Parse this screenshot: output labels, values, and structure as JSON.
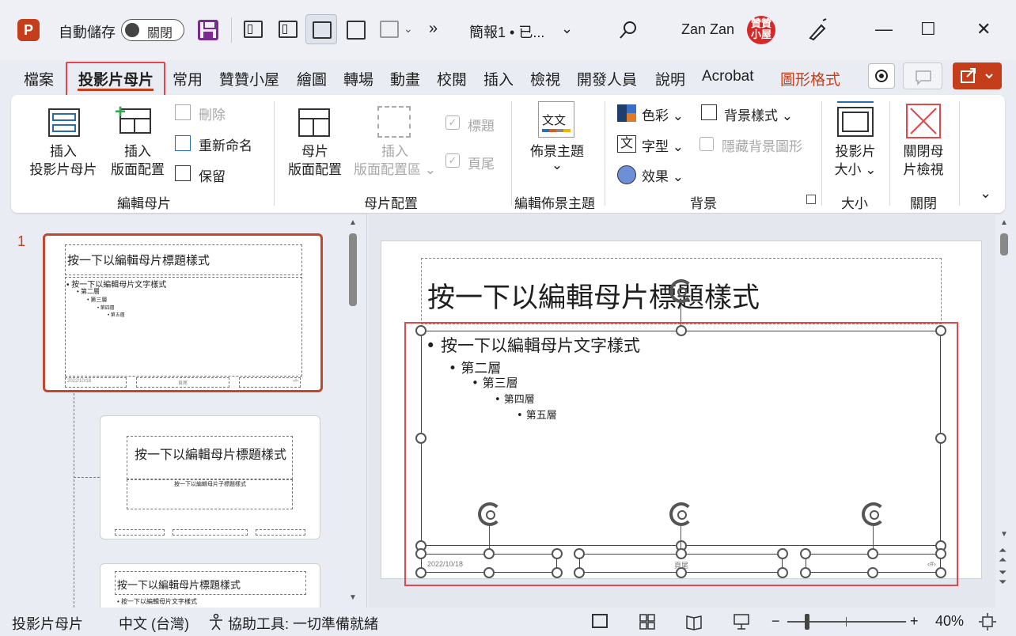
{
  "titlebar": {
    "app_logo": "P",
    "autosave_label": "自動儲存",
    "autosave_state": "關閉",
    "doc_title": "簡報1 • 已...",
    "username": "Zan Zan",
    "avatar_text": "贊贊小屋",
    "overflow": "»",
    "minimize": "—",
    "maximize": "☐",
    "close": "✕"
  },
  "tabs": {
    "file": "檔案",
    "slide_master": "投影片母片",
    "home": "常用",
    "zanzan": "贊贊小屋",
    "draw": "繪圖",
    "transitions": "轉場",
    "animations": "動畫",
    "review": "校閱",
    "insert": "插入",
    "view": "檢視",
    "developer": "開發人員",
    "help": "說明",
    "acrobat": "Acrobat",
    "shape_format": "圖形格式"
  },
  "ribbon": {
    "insert_slide_master": [
      "插入",
      "投影片母片"
    ],
    "insert_layout": [
      "插入",
      "版面配置"
    ],
    "delete": "刪除",
    "rename": "重新命名",
    "preserve": "保留",
    "group_edit_master": "編輯母片",
    "master_layout": [
      "母片",
      "版面配置"
    ],
    "insert_placeholder": [
      "插入",
      "版面配置區 ⌄"
    ],
    "title_check": "標題",
    "footer_check": "頁尾",
    "group_master_layout": "母片配置",
    "themes": "佈景主題",
    "themes_chev": "⌄",
    "group_edit_theme": "編輯佈景主題",
    "colors": "色彩 ⌄",
    "fonts": "字型 ⌄",
    "effects": "效果 ⌄",
    "bg_styles": "背景樣式 ⌄",
    "hide_bg": "隱藏背景圖形",
    "group_background": "背景",
    "slide_size": [
      "投影片",
      "大小 ⌄"
    ],
    "group_size": "大小",
    "close_master": [
      "關閉母",
      "片檢視"
    ],
    "group_close": "關閉",
    "fonts_icon_char": "文",
    "themes_icon_char": "文文"
  },
  "thumbnails": {
    "index": "1",
    "t1_title": "按一下以編輯母片標題樣式",
    "t1_body": [
      "• 按一下以編輯母片文字樣式",
      "• 第二層",
      "• 第三層",
      "• 第四層",
      "• 第五層"
    ],
    "t1_footer": [
      "2022/10/18",
      "頁尾",
      "‹#›"
    ],
    "t2_title": "按一下以編輯母片標題樣式",
    "t2_sub": "按一下以編輯母片子標題樣式",
    "t3_title": "按一下以編輯母片標題樣式",
    "t3_body": "• 按一下以編輯母片文字樣式"
  },
  "slide": {
    "title": "按一下以編輯母片標題樣式",
    "level1": "• 按一下以編輯母片文字樣式",
    "level2": "• 第二層",
    "level3": "• 第三層",
    "level4": "• 第四層",
    "level5": "• 第五層",
    "date": "2022/10/18",
    "footer": "頁尾",
    "page_num": "‹#›"
  },
  "status": {
    "view_name": "投影片母片",
    "language": "中文 (台灣)",
    "accessibility": "協助工具: 一切準備就緒",
    "zoom_minus": "−",
    "zoom_plus": "+",
    "zoom": "40%",
    "zoom_level": 0.4
  },
  "colors": {
    "accent": "#c43e1c",
    "highlight": "#e0484e"
  }
}
